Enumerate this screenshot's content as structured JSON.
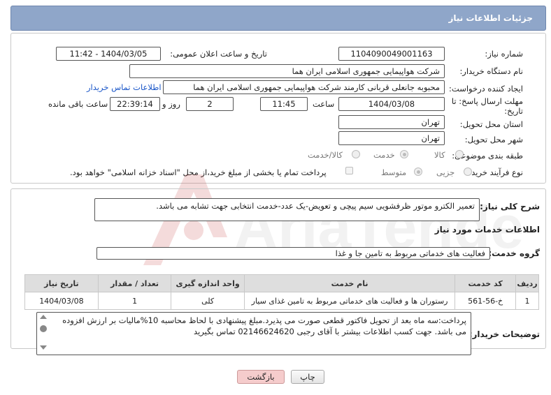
{
  "header": {
    "title": "جزئیات اطلاعات نیاز"
  },
  "form": {
    "need_number_label": "شماره نیاز:",
    "need_number": "1104090049001163",
    "announce_label": "تاریخ و ساعت اعلان عمومی:",
    "announce_value": "1404/03/05 - 11:42",
    "buyer_org_label": "نام دستگاه خریدار:",
    "buyer_org": "شرکت هواپیمایی جمهوری اسلامی ایران هما",
    "requester_label": "ایجاد کننده درخواست:",
    "requester": "محبوبه جانعلی قربانی کارمند شرکت هواپیمایی جمهوری اسلامی ایران هما",
    "contact_link": "اطلاعات تماس خریدار",
    "deadline_label_line1": "مهلت ارسال پاسخ: تا",
    "deadline_label_line2": "تاریخ:",
    "deadline_date": "1404/03/08",
    "time_label": "ساعت",
    "deadline_time": "11:45",
    "days_value": "2",
    "days_label": "روز و",
    "remaining_time": "22:39:14",
    "remaining_label": "ساعت باقی مانده",
    "province_label": "استان محل تحویل:",
    "province": "تهران",
    "city_label": "شهر محل تحویل:",
    "city": "تهران",
    "category_label": "طبقه بندی موضوعی:",
    "category_options": [
      "کالا",
      "خدمت",
      "کالا/خدمت"
    ],
    "process_label": "نوع فرآیند خرید :",
    "process_options": [
      "جزیی",
      "متوسط"
    ],
    "payment_note": "پرداخت تمام یا بخشی از مبلغ خرید،از محل \"اسناد خزانه اسلامی\" خواهد بود."
  },
  "details": {
    "summary_label": "شرح کلی نیاز:",
    "summary": "تعمیر الکترو موتور ظرفشویی سیم پیچی و تعویض-یک عدد-خدمت  انتخابی جهت تشابه می باشد.",
    "services_title": "اطلاعات خدمات مورد نیاز",
    "service_group_label": "گروه خدمت:",
    "service_group": "فعالیت های خدماتی مربوط به تامین جا و غذا",
    "table": {
      "headers": [
        "ردیف",
        "کد خدمت",
        "نام خدمت",
        "واحد اندازه گیری",
        "تعداد / مقدار",
        "تاریخ نیاز"
      ],
      "rows": [
        [
          "1",
          "خ-56-561",
          "رستوران ها و فعالیت های خدماتی مربوط به تامین غذای سیار",
          "کلی",
          "1",
          "1404/03/08"
        ]
      ]
    },
    "buyer_notes_label": "توضیحات خریدار:",
    "buyer_notes": "پرداخت:سه ماه بعد از تحویل فاکتور قطعی صورت می پذیرد.مبلغ پیشنهادی با لحاظ محاسبه 10%مالیات بر ارزش افزوده می باشد. جهت کسب اطلاعات بیشتر با آقای رجبی 02146624620 تماس بگیرید"
  },
  "buttons": {
    "print": "چاپ",
    "back": "بازگشت"
  },
  "watermark": {
    "text": "AriaTender.neT"
  }
}
